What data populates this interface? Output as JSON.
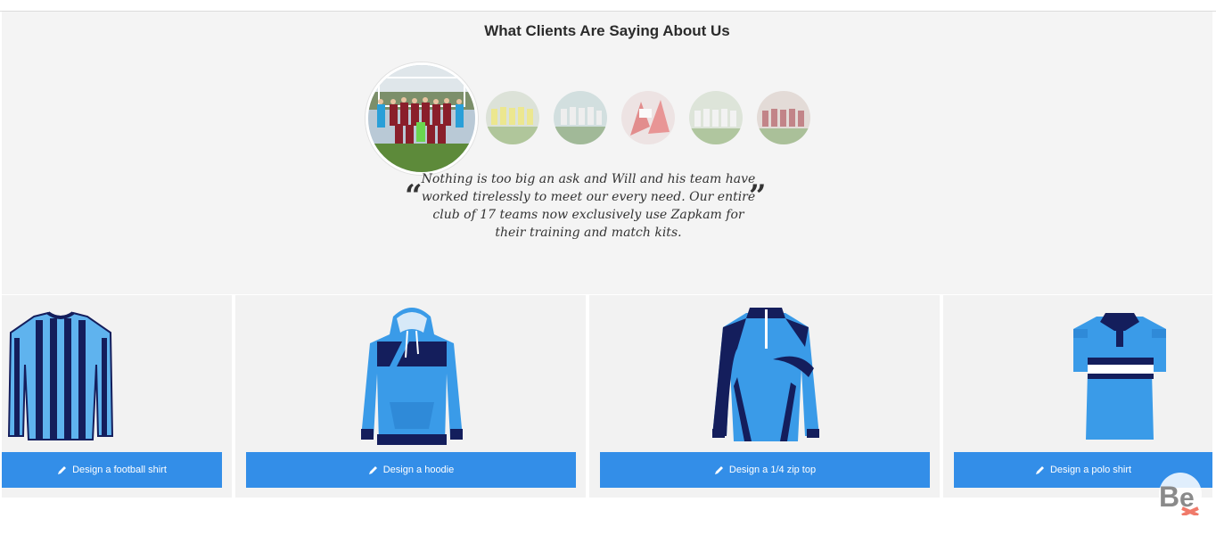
{
  "testimonials": {
    "title": "What Clients Are Saying About Us",
    "quote_open": "“",
    "quote_close": "”",
    "quote": "Nothing is too big an ask and Will and his team have worked tirelessly to meet our every need. Our entire club of 17 teams now exclusively use Zapkam for their training and match kits.",
    "avatars": [
      "team-photo-maroon-kit",
      "team-photo-yellow-kit",
      "team-photo-white-kit",
      "team-photo-red-kit",
      "team-photo-white-kit-2",
      "team-photo-maroon-kit-2"
    ]
  },
  "products": [
    {
      "label": "Design a football shirt",
      "icon": "pencil-icon"
    },
    {
      "label": "Design a hoodie",
      "icon": "pencil-icon"
    },
    {
      "label": "Design a 1/4 zip top",
      "icon": "pencil-icon"
    },
    {
      "label": "Design a polo shirt",
      "icon": "pencil-icon"
    }
  ],
  "colors": {
    "accent": "#338ee8",
    "navy": "#141e5c",
    "sky": "#3a9be8",
    "panel": "#f4f4f4"
  },
  "watermark": {
    "logo": "behance-style-logo"
  }
}
